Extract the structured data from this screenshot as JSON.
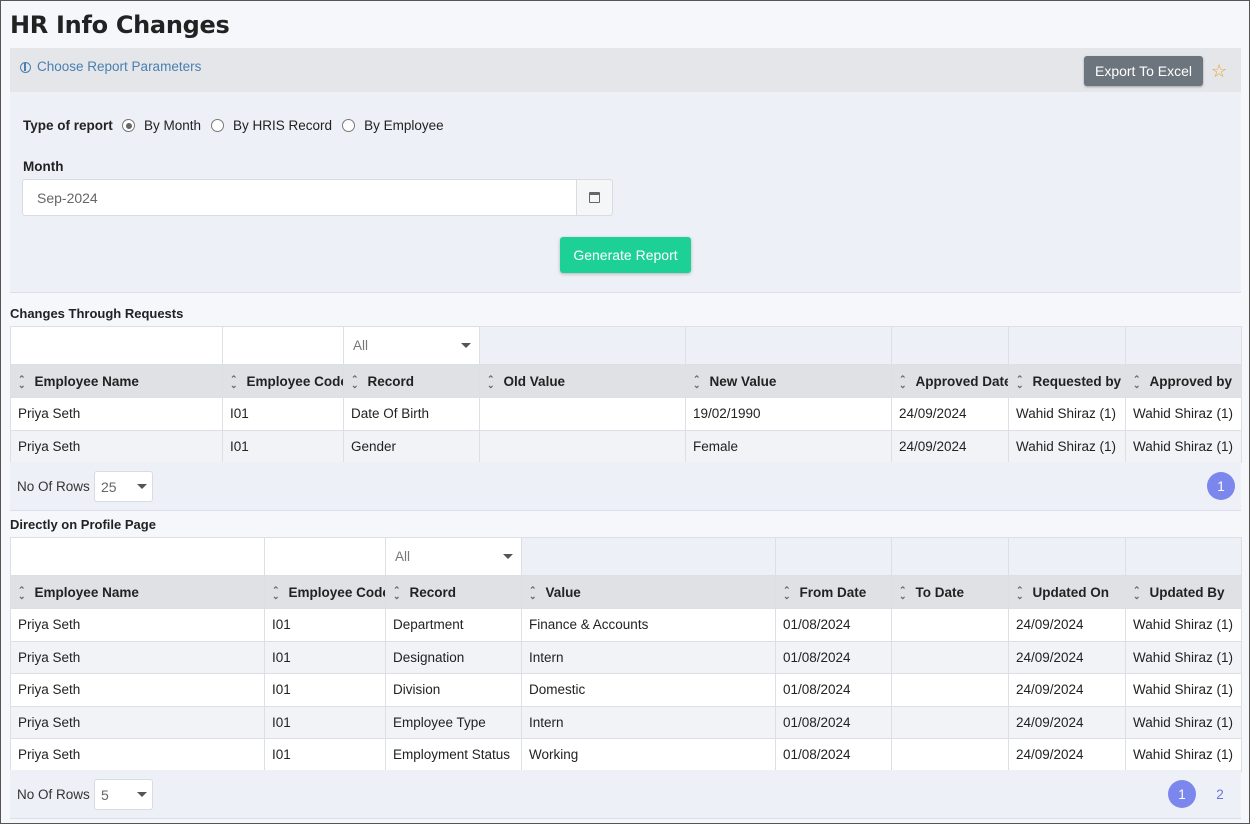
{
  "page": {
    "title": "HR Info Changes"
  },
  "params": {
    "link_label": "Choose Report Parameters",
    "export_label": "Export To Excel",
    "type_label": "Type of report",
    "radios": [
      {
        "label": "By Month",
        "checked": true
      },
      {
        "label": "By HRIS Record",
        "checked": false
      },
      {
        "label": "By Employee",
        "checked": false
      }
    ],
    "month_label": "Month",
    "month_value": "Sep-2024",
    "generate_label": "Generate Report"
  },
  "requests": {
    "title": "Changes Through Requests",
    "record_filter": "All",
    "columns": [
      "Employee Name",
      "Employee Code",
      "Record",
      "Old Value",
      "New Value",
      "Approved Date",
      "Requested by",
      "Approved by"
    ],
    "rows": [
      [
        "Priya Seth",
        "I01",
        "Date Of Birth",
        "",
        "19/02/1990",
        "24/09/2024",
        "Wahid Shiraz (1)",
        "Wahid Shiraz (1)"
      ],
      [
        "Priya Seth",
        "I01",
        "Gender",
        "",
        "Female",
        "24/09/2024",
        "Wahid Shiraz (1)",
        "Wahid Shiraz (1)"
      ]
    ],
    "rows_label": "No Of Rows :",
    "rows_value": "25",
    "pages": [
      "1"
    ]
  },
  "profile": {
    "title": "Directly on Profile Page",
    "record_filter": "All",
    "columns": [
      "Employee Name",
      "Employee Code",
      "Record",
      "Value",
      "From Date",
      "To Date",
      "Updated On",
      "Updated By"
    ],
    "rows": [
      [
        "Priya Seth",
        "I01",
        "Department",
        "Finance & Accounts",
        "01/08/2024",
        "",
        "24/09/2024",
        "Wahid Shiraz (1)"
      ],
      [
        "Priya Seth",
        "I01",
        "Designation",
        "Intern",
        "01/08/2024",
        "",
        "24/09/2024",
        "Wahid Shiraz (1)"
      ],
      [
        "Priya Seth",
        "I01",
        "Division",
        "Domestic",
        "01/08/2024",
        "",
        "24/09/2024",
        "Wahid Shiraz (1)"
      ],
      [
        "Priya Seth",
        "I01",
        "Employee Type",
        "Intern",
        "01/08/2024",
        "",
        "24/09/2024",
        "Wahid Shiraz (1)"
      ],
      [
        "Priya Seth",
        "I01",
        "Employment Status",
        "Working",
        "01/08/2024",
        "",
        "24/09/2024",
        "Wahid Shiraz (1)"
      ]
    ],
    "rows_label": "No Of Rows :",
    "rows_value": "5",
    "pages": [
      "1",
      "2"
    ]
  },
  "icons": {
    "param": "chart-pie-icon",
    "calendar": "calendar-icon",
    "favorite": "star-icon",
    "sort": "sort-icon",
    "dropdown": "caret-down-icon"
  }
}
